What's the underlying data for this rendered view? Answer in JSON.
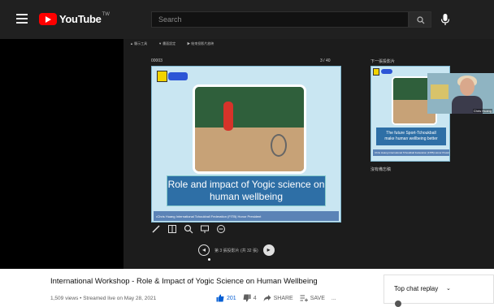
{
  "header": {
    "logo_text": "YouTube",
    "logo_country": "TW",
    "search_placeholder": "Search"
  },
  "zoom": {
    "toolbar": [
      "▲ 顯示工具",
      "▼ 畫面設定",
      "▶ 結束投影片放映"
    ],
    "slide_counter_left": "00003",
    "slide_counter_right": "3 / 40",
    "next_label": "下一張投影片",
    "notes_label": "沒有備忘稿",
    "main_slide": {
      "title_line1": "Role and impact of Yogic science on",
      "title_line2": "human wellbeing",
      "footer": "•Chris Huang   International Tchoukball Federation (FITB) Honor President"
    },
    "next_slide": {
      "title_line1": "The future Sport-Tchoukball",
      "title_line2": "make human wellbeing better",
      "footer": "Chris Huang   International Tchoukball Federation (FITB) Honor President"
    },
    "nav_text": "第 3 張投影片 (共 32 張)",
    "camera_name": "Chris Huang",
    "zoom_logo": "zoom",
    "bottom_hint": "◂ ▸"
  },
  "video": {
    "title": "International Workshop - Role & Impact of Yogic Science on Human Wellbeing",
    "meta": "1,509 views • Streamed live on May 28, 2021",
    "likes": "201",
    "dislikes": "4",
    "share_label": "SHARE",
    "save_label": "SAVE",
    "more_label": "..."
  },
  "chat": {
    "label": "Top chat replay",
    "chevron": "⌄"
  },
  "colors": {
    "brand_red": "#ff0000",
    "like_blue": "#065fd4",
    "slide_blue": "#2e6fa6"
  }
}
